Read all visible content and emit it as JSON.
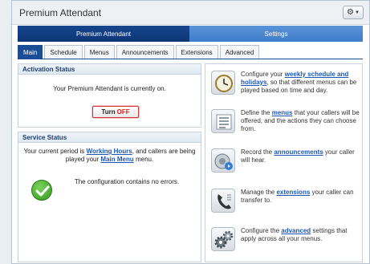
{
  "window": {
    "title": "Premium Attendant"
  },
  "navbar": {
    "items": [
      {
        "label": "Premium Attendant",
        "state": "active"
      },
      {
        "label": "Settings",
        "state": "inactive"
      }
    ]
  },
  "tabs": [
    {
      "label": "Main",
      "active": true
    },
    {
      "label": "Schedule",
      "active": false
    },
    {
      "label": "Menus",
      "active": false
    },
    {
      "label": "Announcements",
      "active": false
    },
    {
      "label": "Extensions",
      "active": false
    },
    {
      "label": "Advanced",
      "active": false
    }
  ],
  "activation": {
    "heading": "Activation Status",
    "status_text": "Your Premium Attendant is currently on.",
    "button_prefix": "Turn",
    "button_suffix": "OFF"
  },
  "service": {
    "heading": "Service Status",
    "line1_pre": "Your current period is ",
    "line1_link": "Working Hours",
    "line1_post": ", and callers are being played your ",
    "line1_link2": "Main Menu",
    "line1_end": " menu.",
    "ok_text": "The configuration contains no errors."
  },
  "features": [
    {
      "icon": "clock-icon",
      "pre": "Configure your ",
      "link": "weekly schedule and holidays",
      "post": ", so that different menus can be played based on time and day."
    },
    {
      "icon": "menu-list-icon",
      "pre": "Define the ",
      "link": "menus",
      "post": " that your callers will be offered, and the actions they can choose from."
    },
    {
      "icon": "speaker-icon",
      "pre": "Record the ",
      "link": "announcements",
      "post": " your caller will hear."
    },
    {
      "icon": "phone-icon",
      "pre": "Manage the ",
      "link": "extensions",
      "post": " your caller can transfer to."
    },
    {
      "icon": "gears-icon",
      "pre": "Configure the ",
      "link": "advanced",
      "post": " settings that apply across all your menus."
    }
  ],
  "colors": {
    "nav_active": "#0d3574",
    "nav_inactive": "#4a86cf",
    "link": "#1c57b3",
    "off_text": "#e01e1e",
    "ok_green": "#2f9a1e"
  }
}
